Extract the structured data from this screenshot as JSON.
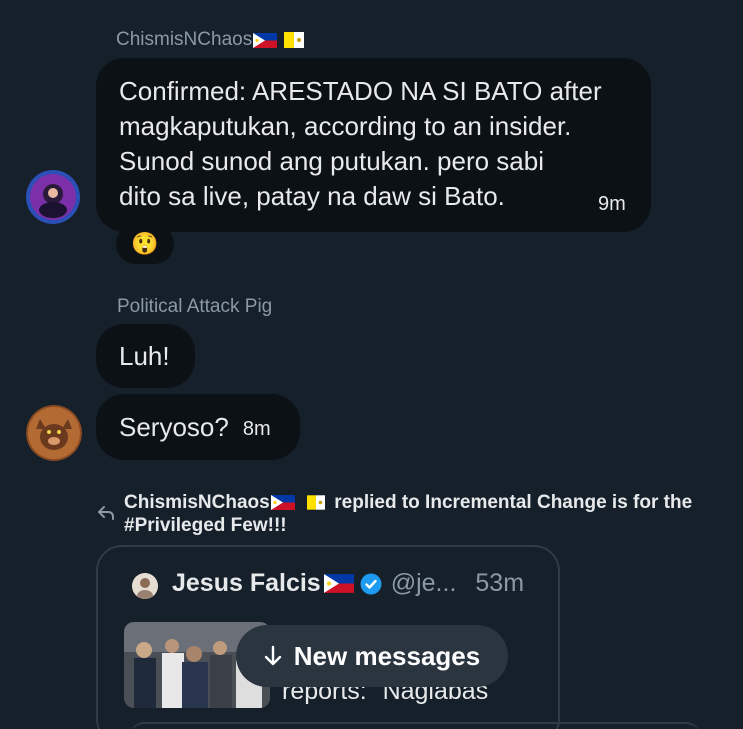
{
  "message1": {
    "sender": "ChismisNChaos",
    "text_lines": [
      "Confirmed:  ARESTADO NA SI BATO after",
      "magkaputukan, according to an insider.",
      "Sunod sunod ang putukan.   pero sabi",
      "dito sa live,  patay na daw si Bato."
    ],
    "time": "9m",
    "reaction": "😲"
  },
  "message2": {
    "sender": "Political Attack Pig",
    "bubble1": "Luh!",
    "bubble2": "Seryoso?",
    "time": "8m"
  },
  "reply": {
    "sender": "ChismisNChaos",
    "text": "replied to Incremental Change is for the",
    "text2": "#Privileged Few!!!"
  },
  "quoted": {
    "name": "Jesus Falcis",
    "handle": "@je...",
    "time": "53m",
    "preview_text": "reports: \"Naglabas"
  },
  "new_messages": {
    "label": "New messages"
  },
  "colors": {
    "background": "#15202b",
    "bubble": "#0c1116",
    "verified": "#1d9bf0"
  }
}
